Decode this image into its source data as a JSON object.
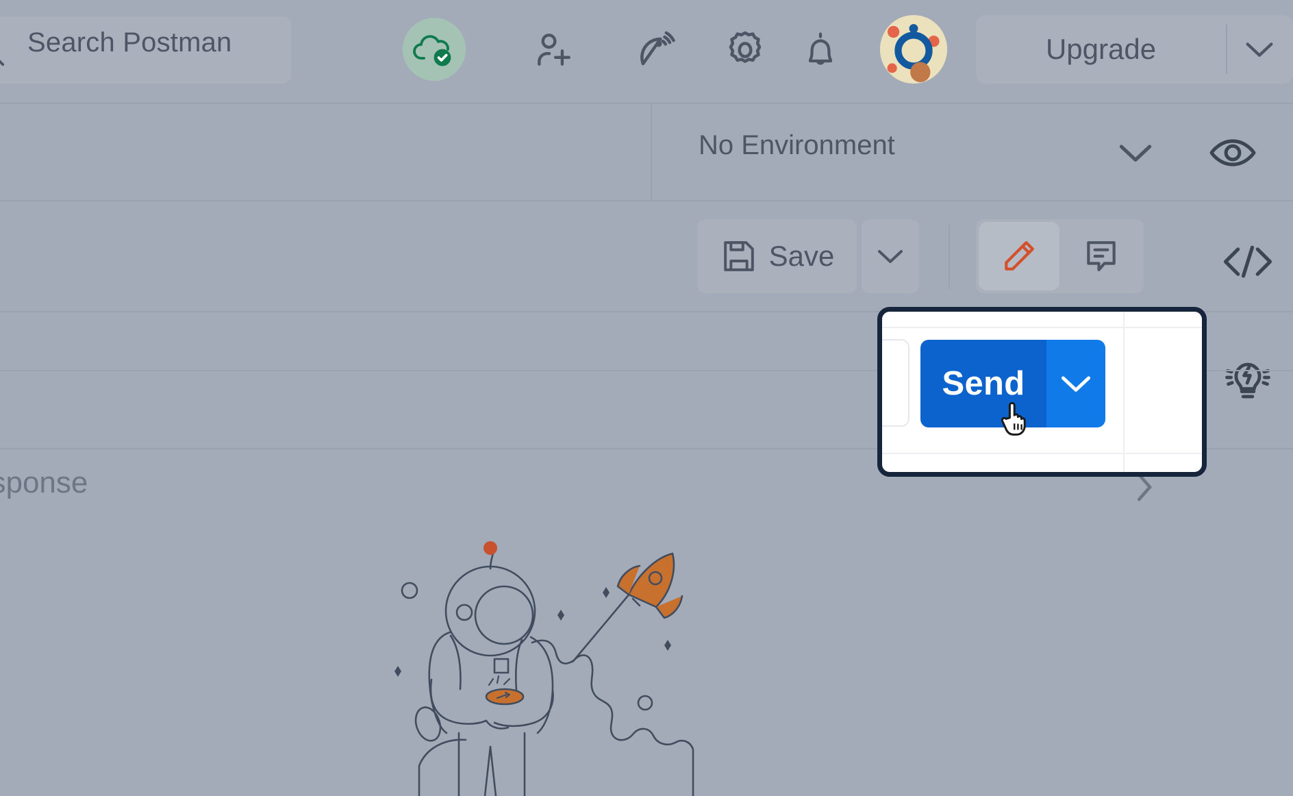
{
  "app": {
    "name": "Postman"
  },
  "header": {
    "search": {
      "placeholder": "Search Postman",
      "icon": "search-icon"
    },
    "icons": [
      {
        "name": "cloud-sync-icon",
        "label": "Synced",
        "color": "#0f7a4e"
      },
      {
        "name": "invite-user-icon",
        "label": "Invite"
      },
      {
        "name": "satellite-dish-icon",
        "label": "Runner"
      },
      {
        "name": "settings-gear-icon",
        "label": "Settings"
      },
      {
        "name": "notification-bell-icon",
        "label": "Notifications"
      }
    ],
    "avatar": {
      "name": "user-avatar"
    },
    "upgrade": {
      "label": "Upgrade",
      "caret_icon": "chevron-down-icon"
    }
  },
  "environment": {
    "selected": "No Environment",
    "caret_icon": "chevron-down-icon",
    "eye_icon": "eye-icon"
  },
  "actions": {
    "save": {
      "label": "Save",
      "icon": "save-disk-icon"
    },
    "save_caret_icon": "chevron-down-icon",
    "edit": {
      "icon": "pencil-icon",
      "active": true,
      "color": "#d4502a"
    },
    "comment": {
      "icon": "comment-icon",
      "active": false
    }
  },
  "right_rail": {
    "code_icon": "code-brackets-icon",
    "postbot_icon": "lightbulb-bolt-icon"
  },
  "response": {
    "label": "esponse",
    "caret_icon": "chevron-right-icon"
  },
  "illustration": {
    "name": "astronaut-rocket-illustration",
    "stroke": "#414d5e",
    "accent": "#c8712f",
    "dot": "#c8512f"
  },
  "spotlight": {
    "border_color": "#16243c",
    "send": {
      "label": "Send",
      "caret_icon": "chevron-down-icon",
      "main_color": "#0c63cd",
      "caret_color": "#117ae9"
    },
    "cursor": "pointer-hand-cursor"
  }
}
